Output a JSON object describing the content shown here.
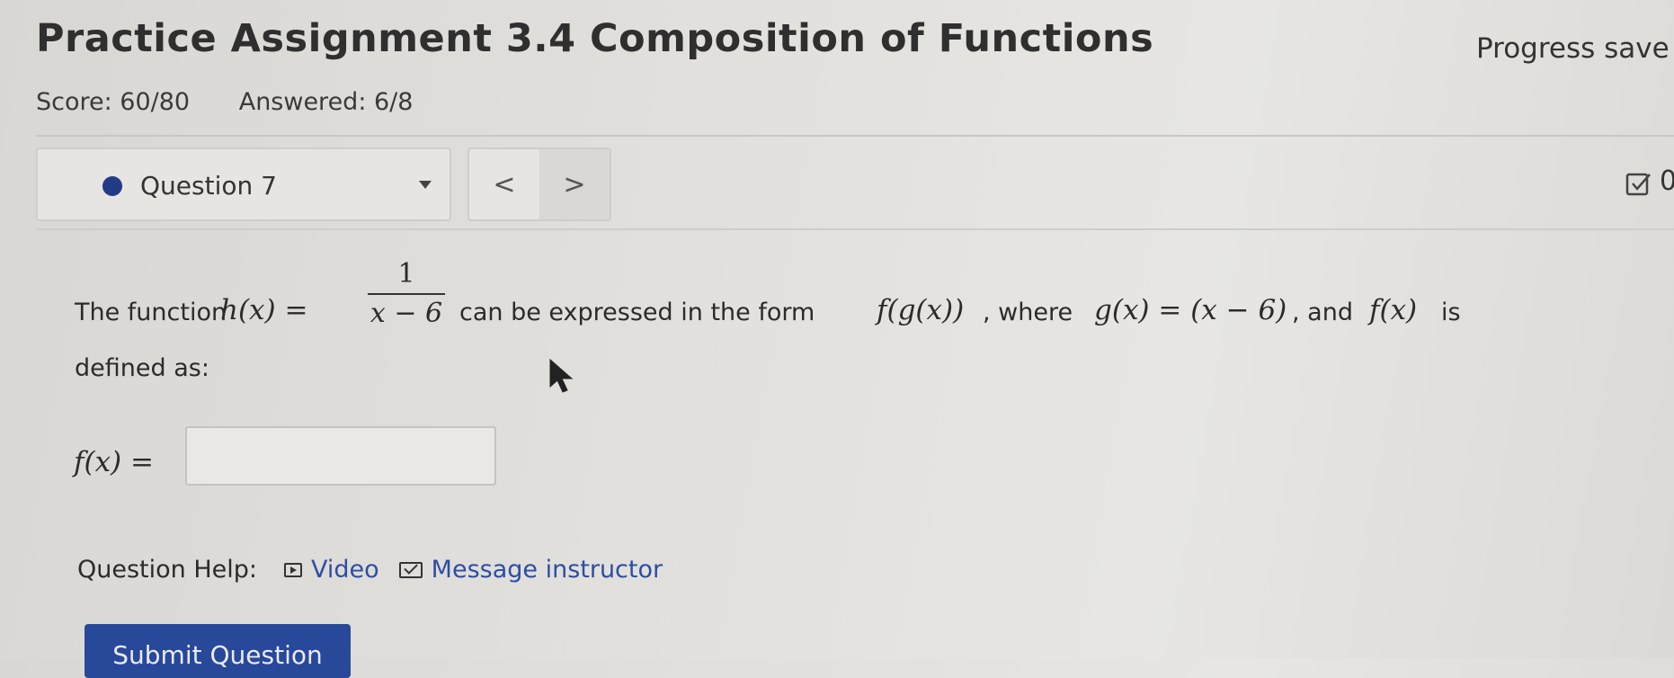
{
  "header": {
    "title": "Practice Assignment 3.4 Composition of Functions",
    "progress": "Progress save"
  },
  "meta": {
    "score": "Score: 60/80",
    "answered": "Answered: 6/8"
  },
  "question_bar": {
    "current": "Question 7",
    "prev": "<",
    "next": ">",
    "score_cut": "0"
  },
  "question": {
    "intro": "The function",
    "h_lhs": "h(x) =",
    "frac_num": "1",
    "frac_den": "x − 6",
    "mid": "can be expressed in the form",
    "fg": "f(g(x))",
    "where": ", where",
    "gx": "g(x) = (x − 6)",
    "and": ", and",
    "fx": "f(x)",
    "is": "is",
    "defined": "defined as:",
    "answer_label": "f(x) =",
    "answer_value": ""
  },
  "help": {
    "label": "Question Help:",
    "video": "Video",
    "message": "Message instructor"
  },
  "submit": {
    "label": "Submit Question"
  },
  "colors": {
    "accent": "#28489a",
    "link": "#2c4ea3",
    "dot": "#233b87"
  }
}
